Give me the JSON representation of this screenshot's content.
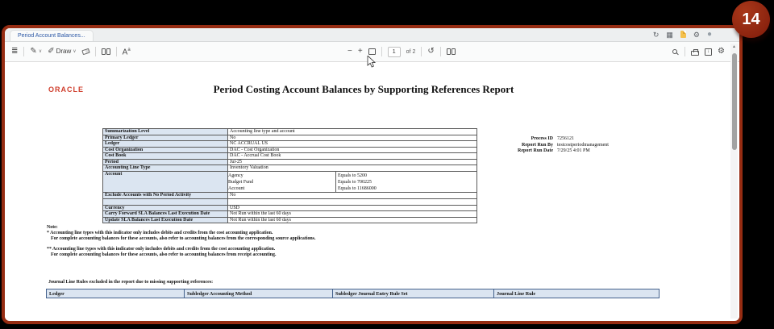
{
  "badge": {
    "value": "14"
  },
  "window": {
    "tab_title": "Period Account Balances..."
  },
  "toolbar": {
    "draw_label": "Draw",
    "page_value": "1",
    "page_of": "of 2"
  },
  "icons": {
    "toc": "≣",
    "highlight": "✎",
    "chevron": "∨",
    "pen": "✐",
    "minus": "−",
    "plus": "+",
    "rotate": "↺",
    "gear": "⚙",
    "refresh": "↻",
    "grid": "▦",
    "scroll_up": "▲",
    "circle": "●",
    "add_text_a": "A",
    "add_text_sup": "a",
    "save_arrow": "↓"
  },
  "document": {
    "logo": "ORACLE",
    "title": "Period Costing Account Balances by Supporting References Report",
    "params": {
      "rows": [
        {
          "label": "Summarization Level",
          "value": "Accounting line type and account"
        },
        {
          "label": "Primary Ledger",
          "value": "No"
        },
        {
          "label": "Ledger",
          "value": "NC ACCRUAL US"
        },
        {
          "label": "Cost Organization",
          "value": "DAC - Cost Organization"
        },
        {
          "label": "Cost Book",
          "value": "DAC - Accrual Cost Book"
        },
        {
          "label": "Period",
          "value": "Jul-25"
        },
        {
          "label": "Accounting Line Type",
          "value": "Inventory Valuation"
        }
      ],
      "account": {
        "label": "Account",
        "segments": [
          {
            "name": "Agency",
            "criteria": "Equals to 5200"
          },
          {
            "name": "Budget Fund",
            "criteria": "Equals to 700225"
          },
          {
            "name": "Account",
            "criteria": "Equals to 11686000"
          }
        ]
      },
      "exclude": {
        "label": "Exclude Accounts with No Period Activity",
        "value": "No"
      },
      "footer": [
        {
          "label": "Currency",
          "value": "USD"
        },
        {
          "label": "Carry Forward SLA Balances Last Execution Date",
          "value": "Not Run within the last 60 days"
        },
        {
          "label": "Update SLA Balances Last Execution Date",
          "value": "Not Run within the last 60 days"
        }
      ]
    },
    "info": [
      {
        "label": "Process ID",
        "value": "7256121"
      },
      {
        "label": "Report Run By",
        "value": "testcostperiodmanagement"
      },
      {
        "label": "Report Run Date",
        "value": "7/29/25 4:01 PM"
      }
    ],
    "notes": {
      "heading": "Note:",
      "line1": "* Accounting line types with this indicator only includes debits and credits from the cost accounting application.",
      "line2": "For complete accounting balances for these accounts, also refer to accounting balances from the corresponding source applications.",
      "line3": "** Accounting line types with this indicator only includes debits and credits from the cost accounting application.",
      "line4": "For complete accounting balances for these accounts, also refer to accounting balances from receipt accounting."
    },
    "journal": {
      "title": "Journal Line Rules excluded in the report due to missing supporting references:",
      "headers": [
        "Ledger",
        "Subledger Accounting Method",
        "Subledger Journal Entry Rule Set",
        "Journal Line Rule"
      ]
    }
  }
}
